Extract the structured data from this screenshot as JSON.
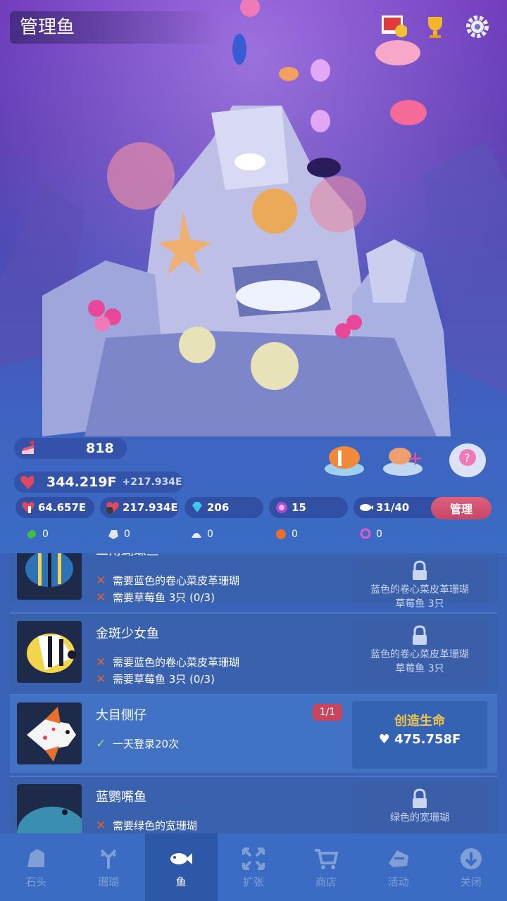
{
  "header": {
    "title": "管理鱼"
  },
  "top_icons": [
    "photo-album-icon",
    "trophy-icon",
    "gear-icon"
  ],
  "stats": {
    "cake": "818",
    "vitality": "344.219F",
    "vitality_rate": "+217.934E",
    "tap": "64.657E",
    "per_sec": "217.934E",
    "diamonds": "206",
    "pearls": "15",
    "fish_count": "31/40",
    "manage_label": "管理",
    "mini": [
      "0",
      "0",
      "0",
      "0",
      "0"
    ]
  },
  "cards": [
    {
      "name": "三角蝴蝶鱼",
      "reqs": [
        {
          "ok": false,
          "text": "需要蓝色的卷心菜皮革珊瑚"
        },
        {
          "ok": false,
          "text": "需要草莓鱼 3只 (0/3)"
        }
      ],
      "right": [
        "蓝色的卷心菜皮革珊瑚",
        "草莓鱼 3只"
      ]
    },
    {
      "name": "金斑少女鱼",
      "reqs": [
        {
          "ok": false,
          "text": "需要蓝色的卷心菜皮革珊瑚"
        },
        {
          "ok": false,
          "text": "需要草莓鱼 3只 (0/3)"
        }
      ],
      "right": [
        "蓝色的卷心菜皮革珊瑚",
        "草莓鱼 3只"
      ]
    },
    {
      "name": "大目侧仔",
      "badge": "1/1",
      "reqs": [
        {
          "ok": true,
          "text": "一天登录20次"
        }
      ],
      "create_label": "创造生命",
      "price": "475.758F"
    },
    {
      "name": "蓝鹦嘴鱼",
      "reqs": [
        {
          "ok": false,
          "text": "需要绿色的宽珊瑚"
        }
      ],
      "right": [
        "绿色的宽珊瑚"
      ]
    }
  ],
  "nav": [
    {
      "label": "石头",
      "icon": "rock-icon"
    },
    {
      "label": "珊瑚",
      "icon": "coral-icon"
    },
    {
      "label": "鱼",
      "icon": "fish-icon",
      "active": true
    },
    {
      "label": "扩张",
      "icon": "expand-icon"
    },
    {
      "label": "商店",
      "icon": "cart-icon"
    },
    {
      "label": "活动",
      "icon": "event-icon"
    },
    {
      "label": "关闭",
      "icon": "close-down-icon"
    }
  ],
  "colors": {
    "accent": "#c44866",
    "create": "#f3c34a",
    "fail": "#e8602e",
    "ok": "#9be062"
  }
}
